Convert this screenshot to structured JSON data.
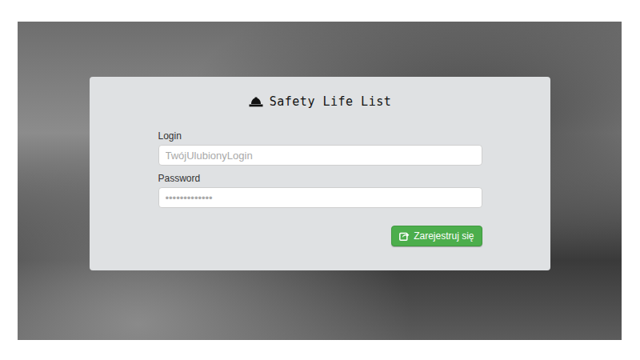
{
  "card": {
    "title": "Safety Life List"
  },
  "fields": [
    {
      "label": "Login",
      "placeholder": "TwójUlubionyLogin"
    },
    {
      "label": "Password",
      "placeholder": "•••••••••••••"
    }
  ],
  "buttons": [
    {
      "label": "Zarejestruj się"
    }
  ]
}
